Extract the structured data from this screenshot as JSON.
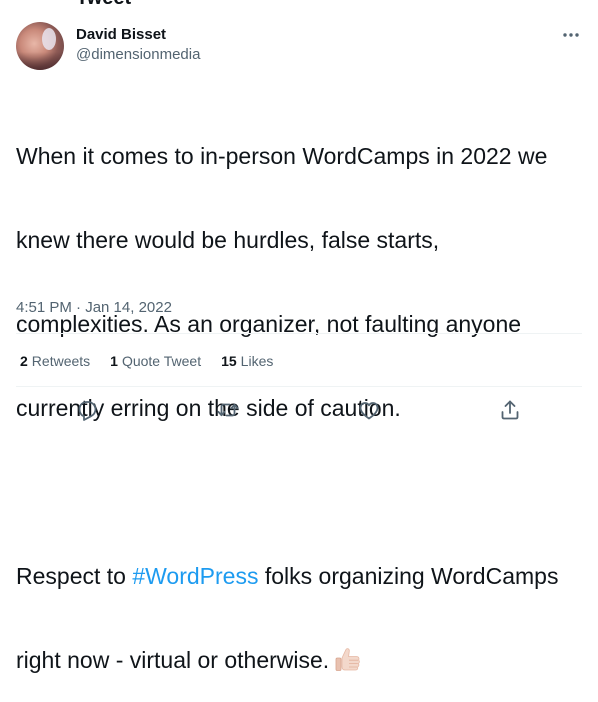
{
  "header": {
    "top_cutoff_text": "Tweet"
  },
  "author": {
    "display_name": "David Bisset",
    "handle": "@dimensionmedia"
  },
  "tweet": {
    "para1_line1": "When it comes to in-person WordCamps in 2022 we",
    "para1_line2": "knew there would be hurdles, false starts,",
    "para1_line3": "complexities. As an organizer, not faulting anyone",
    "para1_line4": "currently erring on the side of caution.",
    "para2_pre": "Respect to ",
    "hashtag": "#WordPress",
    "para2_post": " folks organizing WordCamps",
    "para2_line2": "right now - virtual or otherwise.",
    "emoji": "thumbs-up-icon"
  },
  "timestamp": "4:51 PM · Jan 14, 2022",
  "stats": {
    "retweets_count": "2",
    "retweets_label": "Retweets",
    "quotes_count": "1",
    "quotes_label": "Quote Tweet",
    "likes_count": "15",
    "likes_label": "Likes"
  },
  "actions": [
    "reply-icon",
    "retweet-icon",
    "like-icon",
    "share-icon"
  ],
  "colors": {
    "link": "#1d9bf0",
    "text": "#0f1419",
    "muted": "#536471",
    "divider": "#eff3f4"
  }
}
